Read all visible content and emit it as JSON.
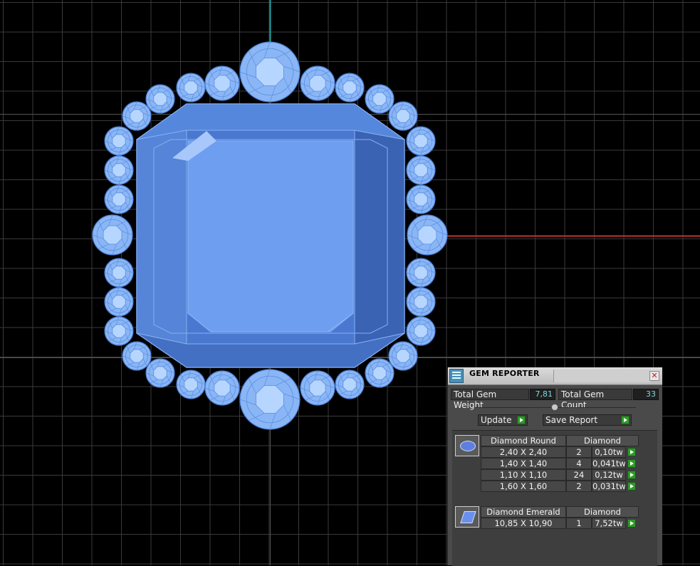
{
  "viewport": {
    "grid_color": "#3a3a3a",
    "axis_x_color": "#c83030",
    "axis_y_color": "#1aa0a0",
    "gem_fill": "#6e9ef0",
    "gem_dark": "#3f67b8"
  },
  "panel": {
    "title": "GEM REPORTER",
    "close_glyph": "✕",
    "total_weight_label": "Total Gem Weight",
    "total_weight_value": "7,81",
    "total_count_label": "Total Gem Count",
    "total_count_value": "33",
    "update_label": "Update",
    "save_report_label": "Save Report"
  },
  "groups": [
    {
      "icon": "round-diamond-icon",
      "cut": "Diamond Round",
      "material": "Diamond",
      "rows": [
        {
          "size": "2,40 X 2,40",
          "count": "2",
          "weight": "0,10tw"
        },
        {
          "size": "1,40 X 1,40",
          "count": "4",
          "weight": "0,041tw"
        },
        {
          "size": "1,10 X 1,10",
          "count": "24",
          "weight": "0,12tw"
        },
        {
          "size": "1,60 X 1,60",
          "count": "2",
          "weight": "0,031tw"
        }
      ]
    },
    {
      "icon": "emerald-diamond-icon",
      "cut": "Diamond Emerald",
      "material": "Diamond",
      "rows": [
        {
          "size": "10,85 X 10,90",
          "count": "1",
          "weight": "7,52tw"
        }
      ]
    }
  ]
}
